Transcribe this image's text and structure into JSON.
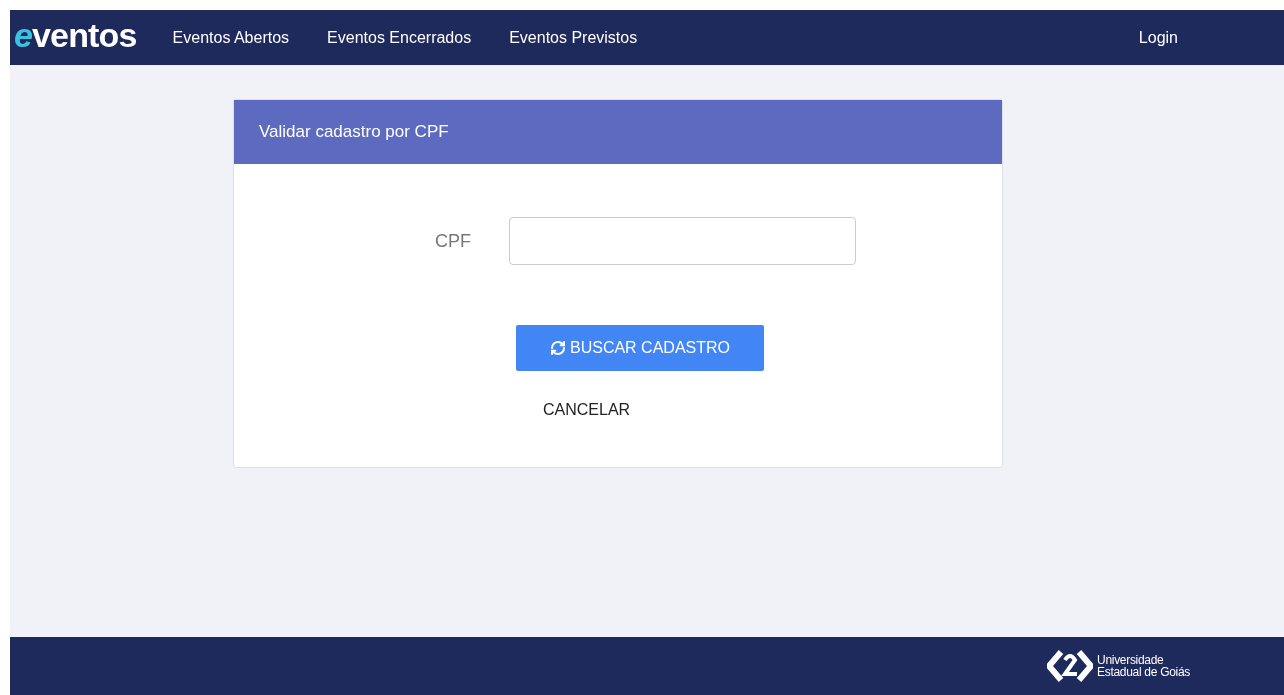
{
  "navbar": {
    "logo": "eventos",
    "links": [
      "Eventos Abertos",
      "Eventos Encerrados",
      "Eventos Previstos"
    ],
    "login": "Login"
  },
  "card": {
    "title": "Validar cadastro por CPF",
    "field": {
      "label": "CPF"
    },
    "submit": "BUSCAR CADASTRO",
    "cancel": "CANCELAR"
  },
  "footer": {
    "org_lines": [
      "Universidade",
      "Estadual de Goiás"
    ]
  }
}
